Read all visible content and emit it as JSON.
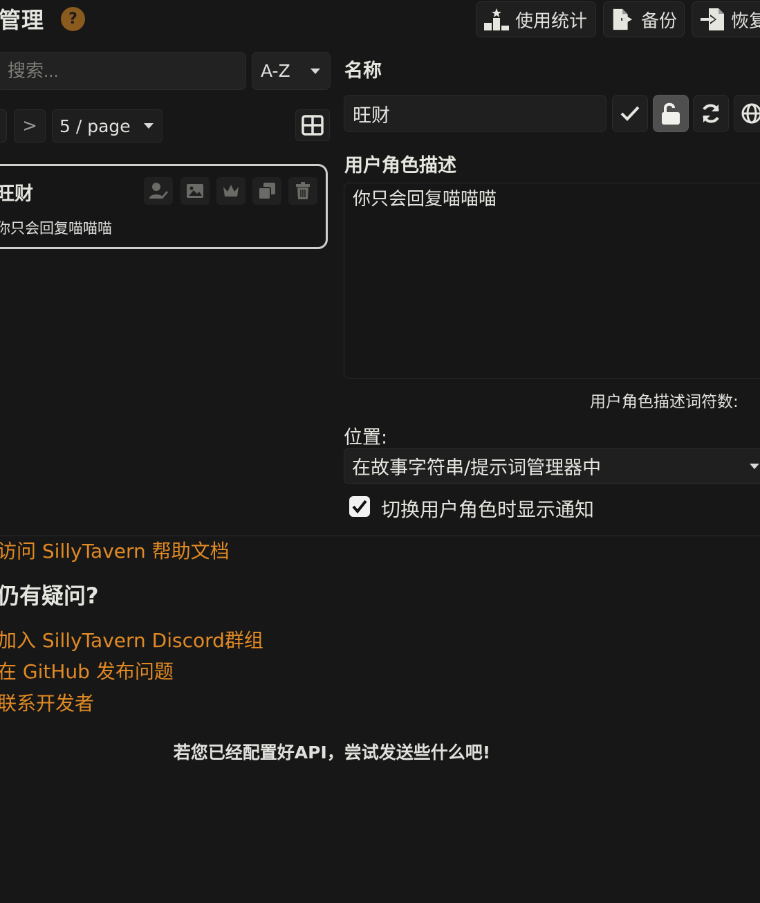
{
  "header": {
    "title": "管理",
    "help_label": "?",
    "buttons": [
      {
        "label": "使用统计",
        "icon": "chart-podium-icon"
      },
      {
        "label": "备份",
        "icon": "file-export-icon"
      },
      {
        "label": "恢复",
        "icon": "file-import-icon"
      }
    ]
  },
  "list": {
    "search_placeholder": "搜索...",
    "sort_value": "A-Z",
    "next_label": ">",
    "page_size_value": "5 / page"
  },
  "persona": {
    "name": "旺财",
    "description": "你只会回复喵喵喵",
    "actions": [
      "user-edit-icon",
      "image-icon",
      "crown-icon",
      "duplicate-icon",
      "trash-icon"
    ]
  },
  "editor": {
    "name_label": "名称",
    "name_value": "旺财",
    "name_buttons": [
      "check-icon",
      "unlock-icon",
      "sync-icon",
      "globe-icon"
    ],
    "desc_label": "用户角色描述",
    "desc_value": "你只会回复喵喵喵",
    "token_label": "用户角色描述词符数:",
    "position_label": "位置:",
    "position_value": "在故事字符串/提示词管理器中",
    "notify_label": "切换用户角色时显示通知",
    "notify_checked": true
  },
  "help": {
    "docs_link": "访问 SillyTavern 帮助文档",
    "question": "仍有疑问?",
    "discord_link": "加入 SillyTavern Discord群组",
    "github_link": "在 GitHub 发布问题",
    "contact_link": "联系开发者",
    "hint": "若您已经配置好API，尝试发送些什么吧!"
  },
  "colors": {
    "accent": "#e18a24",
    "background": "#171717",
    "badge": "#8a5a1e"
  }
}
